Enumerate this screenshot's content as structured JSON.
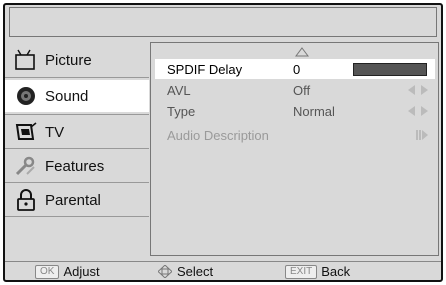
{
  "menu": {
    "items": [
      {
        "label": "Picture",
        "icon": "picture-icon"
      },
      {
        "label": "Sound",
        "icon": "sound-icon"
      },
      {
        "label": "TV",
        "icon": "tv-icon"
      },
      {
        "label": "Features",
        "icon": "features-icon"
      },
      {
        "label": "Parental",
        "icon": "parental-icon"
      }
    ],
    "active_index": 1
  },
  "settings": {
    "rows": [
      {
        "name": "SPDIF Delay",
        "value": "0",
        "state": "selected"
      },
      {
        "name": "AVL",
        "value": "Off",
        "state": "normal"
      },
      {
        "name": "Type",
        "value": "Normal",
        "state": "normal"
      },
      {
        "name": "Audio Description",
        "value": "",
        "state": "disabled"
      }
    ],
    "spdif_delay_level": 1.0
  },
  "footer": {
    "ok_key": "OK",
    "ok_label": "Adjust",
    "select_label": "Select",
    "exit_key": "EXIT",
    "exit_label": "Back"
  },
  "colors": {
    "background": "#d9d9d9",
    "selected_row": "#ffffff",
    "slider_fill": "#555555"
  }
}
